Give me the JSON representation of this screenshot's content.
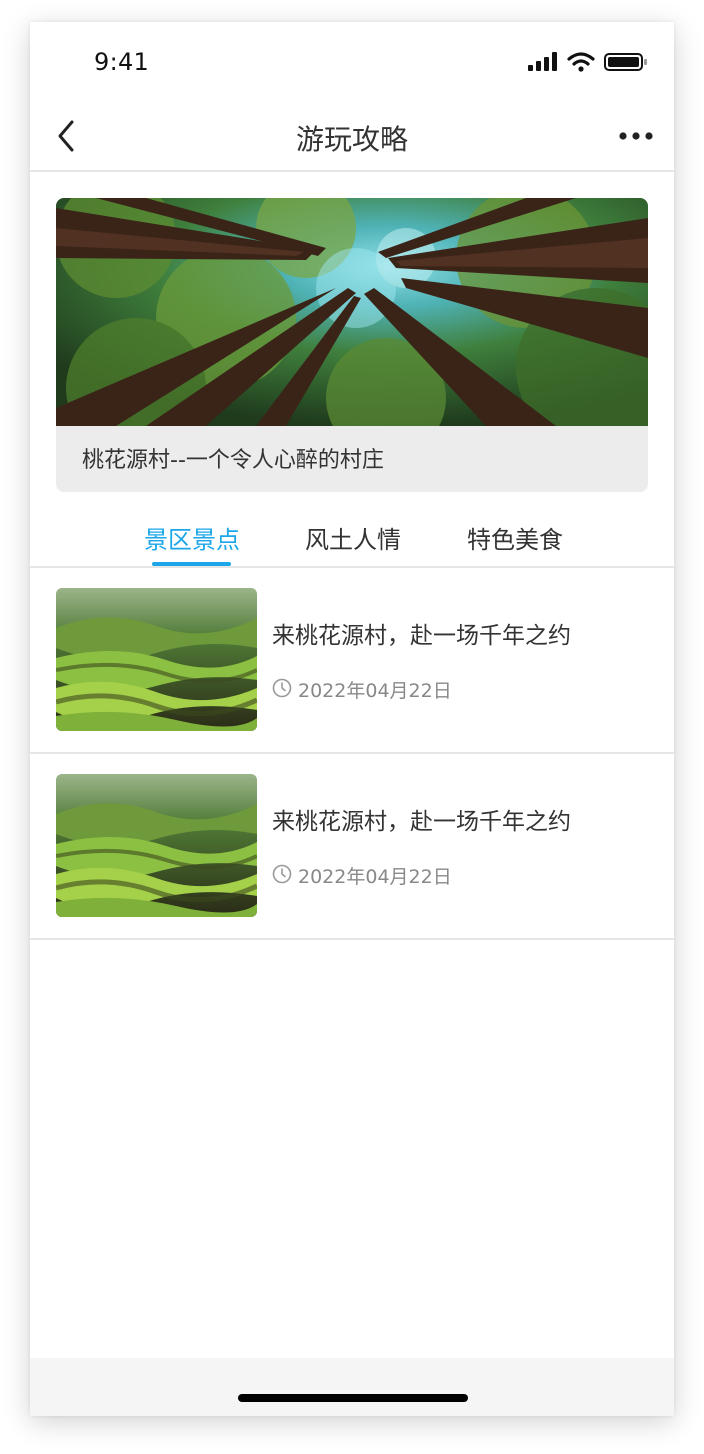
{
  "status_bar": {
    "time": "9:41",
    "icons": [
      "signal-icon",
      "wifi-icon",
      "battery-icon"
    ]
  },
  "nav": {
    "title": "游玩攻略",
    "back_icon": "chevron-left-icon",
    "more_icon": "more-dots-icon"
  },
  "banner": {
    "caption": "桃花源村--一个令人心醉的村庄"
  },
  "tabs": [
    {
      "label": "景区景点",
      "active": true
    },
    {
      "label": "风土人情",
      "active": false
    },
    {
      "label": "特色美食",
      "active": false
    }
  ],
  "articles": [
    {
      "title": "来桃花源村，赴一场千年之约",
      "date": "2022年04月22日"
    },
    {
      "title": "来桃花源村，赴一场千年之约",
      "date": "2022年04月22日"
    }
  ],
  "colors": {
    "accent": "#1aa6e8",
    "text_primary": "#333333",
    "text_secondary": "#888888",
    "divider": "#e6e6e6"
  }
}
